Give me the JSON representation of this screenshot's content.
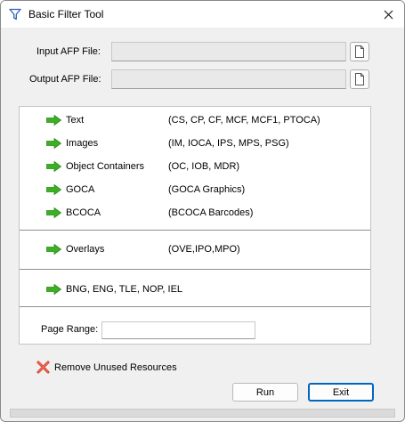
{
  "window": {
    "title": "Basic Filter Tool"
  },
  "icons": {
    "title": "filter-funnel-icon",
    "close": "close-icon",
    "file": "document-icon",
    "arrow": "green-arrow-icon",
    "remove": "red-x-icon"
  },
  "files": {
    "input_label": "Input AFP File:",
    "input_value": "",
    "output_label": "Output AFP File:",
    "output_value": ""
  },
  "options": [
    {
      "label": "Text",
      "desc": "(CS, CP, CF, MCF, MCF1, PTOCA)"
    },
    {
      "label": "Images",
      "desc": "(IM, IOCA, IPS, MPS, PSG)"
    },
    {
      "label": "Object Containers",
      "desc": "(OC, IOB, MDR)"
    },
    {
      "label": "GOCA",
      "desc": "(GOCA Graphics)"
    },
    {
      "label": "BCOCA",
      "desc": "(BCOCA Barcodes)"
    },
    {
      "label": "Overlays",
      "desc": "(OVE,IPO,MPO)"
    },
    {
      "label": "BNG, ENG, TLE, NOP, IEL",
      "desc": ""
    }
  ],
  "page_range": {
    "label": "Page Range:",
    "value": ""
  },
  "remove_unused": {
    "label": "Remove Unused Resources"
  },
  "buttons": {
    "run": "Run",
    "exit": "Exit"
  },
  "colors": {
    "accent": "#0067c0",
    "arrow_green": "#3cb023",
    "remove_red": "#d83b2a"
  }
}
